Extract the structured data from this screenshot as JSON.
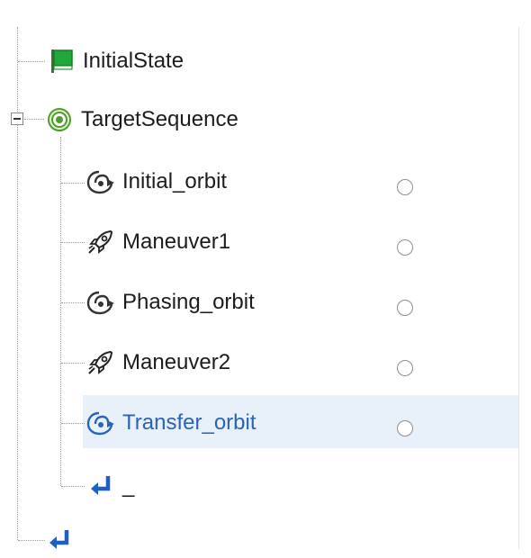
{
  "tree": {
    "root_items": [
      {
        "label": "InitialState",
        "icon": "green-flag-icon"
      },
      {
        "label": "TargetSequence",
        "icon": "target-sequence-icon",
        "expanded": true
      }
    ],
    "sequence_items": [
      {
        "label": "Initial_orbit",
        "icon": "propagate-orbit-icon",
        "selected": false
      },
      {
        "label": "Maneuver1",
        "icon": "rocket-icon",
        "selected": false
      },
      {
        "label": "Phasing_orbit",
        "icon": "propagate-orbit-icon",
        "selected": false
      },
      {
        "label": "Maneuver2",
        "icon": "rocket-icon",
        "selected": false
      },
      {
        "label": "Transfer_orbit",
        "icon": "propagate-orbit-icon",
        "selected": true
      }
    ],
    "sequence_end": {
      "label": "_",
      "icon": "return-arrow-icon"
    },
    "root_end": {
      "icon": "return-arrow-icon"
    }
  },
  "colors": {
    "selected_text": "#2b63b7",
    "selected_background": "#e8f1fa",
    "return_arrow": "#1f5fc4",
    "flag_green": "#22a73a"
  }
}
